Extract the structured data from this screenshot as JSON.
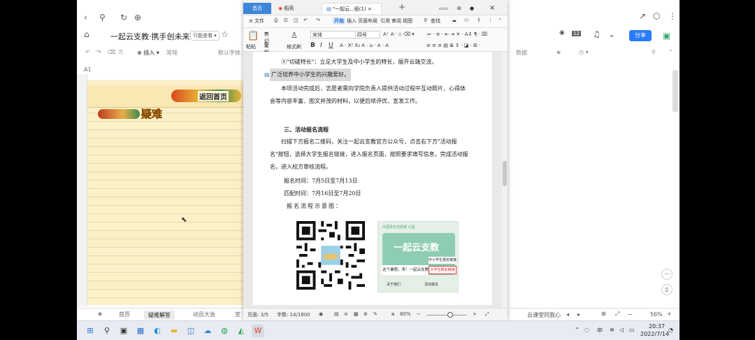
{
  "browser": {
    "doc_title": "一起云支教·携手创未来",
    "readonly_badge": "只能查看 ▾",
    "share_label": "分享",
    "avatar_count": "12",
    "cell_ref": "A1",
    "insert_label": "⊕ 插入 ▾",
    "normal_label": "常规",
    "default_font": "默认字体"
  },
  "sheet": {
    "return_label": "返回首页",
    "yinan_label": "疑难",
    "tabs": [
      "首页",
      "疑难解答",
      "动员大会",
      "宣"
    ]
  },
  "right_panel": {
    "data_label": "数据",
    "bottom_text": "云课堂同我心",
    "zoom": "56%"
  },
  "wps": {
    "tab_home": "首页",
    "tab_docer": "稻壳",
    "tab_doc": "\"一起云...纸(1)",
    "menu": [
      "≡ 文件",
      "开始",
      "插入",
      "页面布局",
      "引用",
      "审阅",
      "视图",
      "查找"
    ],
    "ribbon": {
      "cut": "剪切",
      "copy": "复制",
      "format_painter": "格式刷",
      "paste": "粘贴",
      "font": "宋体",
      "size": "四号"
    },
    "status": {
      "page": "页面: 3/5",
      "words": "字数: 14/1800",
      "zoom": "80%"
    }
  },
  "doc": {
    "para_link_1": "⑤\"切磋特长\"：立足大学生及中小学生的特长，展开云端交流，",
    "para_link_2": "广泛培养中小学生的兴趣爱好。",
    "para_after": "本项活动完成后，志愿者需向学院负责人提供活动过程中互动照片、心得体会等内容丰富、图文并茂的材料，以便后续评优、宣发工作。",
    "heading_3": "三、活动报名流程",
    "para_signup": "扫描下方报名二维码，关注一起云支教官方公众号，点击右下方\"活动报名\"按钮，选择大学生报名链接，进入报名页面，按照要求填写信息，完成活动报名，进入校方审核流程。",
    "signup_time": "报名时间：7月5日至7月13日",
    "match_time": "匹配时间：7月16日至7月20日",
    "flow_label": "报名流程示意图：",
    "poster": {
      "head": "中国青年志愿者  公益",
      "title": "一起云支教",
      "msg": "这个暑假，来！一起云支教",
      "btn_primary": "中小学生报名链接",
      "btn_college": "大学生报名链接",
      "foot_left": "关于我们",
      "foot_right": "活动报名"
    }
  },
  "taskbar": {
    "ime": "中",
    "time": "20:37",
    "date": "2022/7/14"
  }
}
